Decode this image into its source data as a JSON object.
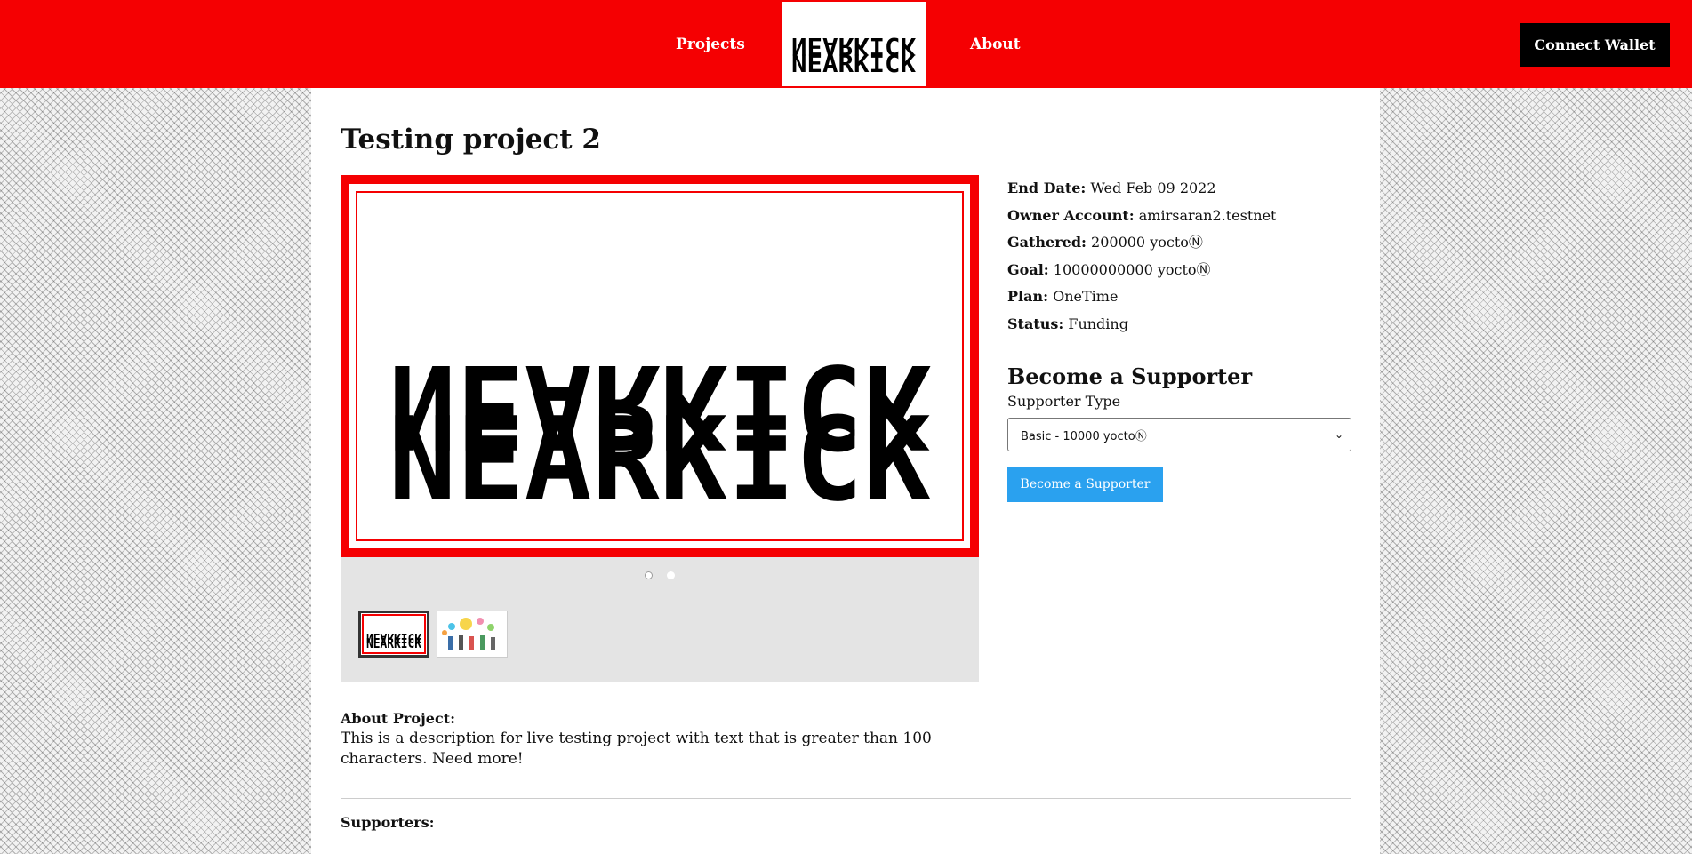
{
  "header": {
    "nav_projects": "Projects",
    "nav_about": "About",
    "logo_text_top": "NEARKICK",
    "logo_text_bottom": "NEARKICK",
    "connect_wallet": "Connect Wallet",
    "brand_color": "#f50002"
  },
  "project": {
    "title": "Testing project 2",
    "details": {
      "end_date_label": "End Date:",
      "end_date_value": "Wed Feb 09 2022",
      "owner_label": "Owner Account:",
      "owner_value": "amirsaran2.testnet",
      "gathered_label": "Gathered:",
      "gathered_value": "200000 yoctoⓃ",
      "goal_label": "Goal:",
      "goal_value": "10000000000 yoctoⓃ",
      "plan_label": "Plan:",
      "plan_value": "OneTime",
      "status_label": "Status:",
      "status_value": "Funding"
    },
    "gallery": {
      "image_text_top": "NEARKICK",
      "image_text_bottom": "NEARKICK",
      "slides": 2,
      "active_slide": 1
    },
    "about_label": "About Project:",
    "about_text": "This is a description for live testing project with text that is greater than 100 characters. Need more!",
    "supporters_label": "Supporters:"
  },
  "support": {
    "title": "Become a Supporter",
    "type_label": "Supporter Type",
    "selected_option": "Basic - 10000 yoctoⓃ",
    "button_label": "Become a Supporter",
    "button_color": "#2aa1ef"
  }
}
